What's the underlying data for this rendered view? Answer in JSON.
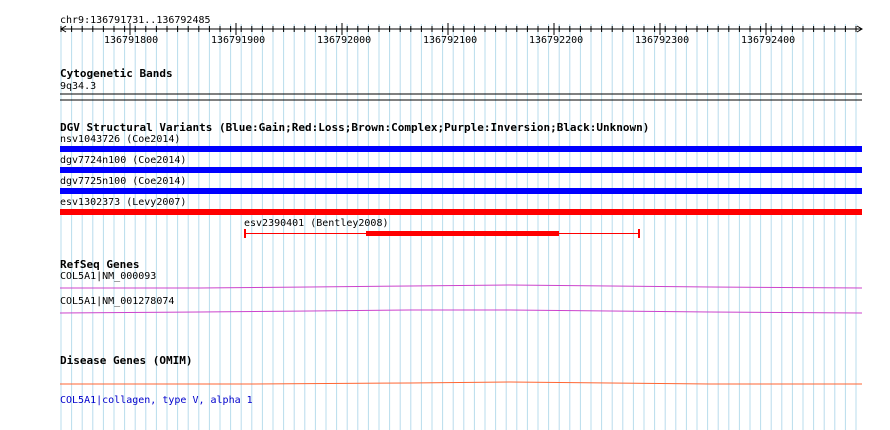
{
  "ruler": {
    "position_label": "chr9:136791731..136792485",
    "ticks": [
      "136791800",
      "136791900",
      "136792000",
      "136792100",
      "136792200",
      "136792300",
      "136792400"
    ]
  },
  "cytoband": {
    "title": "Cytogenetic Bands",
    "band_label": "9q34.3"
  },
  "dgv": {
    "title": "DGV Structural Variants (Blue:Gain;Red:Loss;Brown:Complex;Purple:Inversion;Black:Unknown)",
    "colors": {
      "gain": "#0000ff",
      "loss": "#ff0000"
    },
    "variants": [
      {
        "label": "nsv1043726 (Coe2014)",
        "type": "gain"
      },
      {
        "label": "dgv7724n100 (Coe2014)",
        "type": "gain"
      },
      {
        "label": "dgv7725n100 (Coe2014)",
        "type": "gain"
      },
      {
        "label": "esv1302373 (Levy2007)",
        "type": "loss"
      },
      {
        "label": "esv2390401 (Bentley2008)",
        "type": "loss"
      }
    ]
  },
  "refseq": {
    "title": "RefSeq Genes",
    "color": "#cc44cc",
    "genes": [
      {
        "label": "COL5A1|NM_000093"
      },
      {
        "label": "COL5A1|NM_001278074"
      }
    ]
  },
  "disease": {
    "title": "Disease Genes (OMIM)",
    "color": "#ff6633",
    "genes": [
      {
        "label": "COL5A1|collagen, type V, alpha 1"
      }
    ]
  }
}
